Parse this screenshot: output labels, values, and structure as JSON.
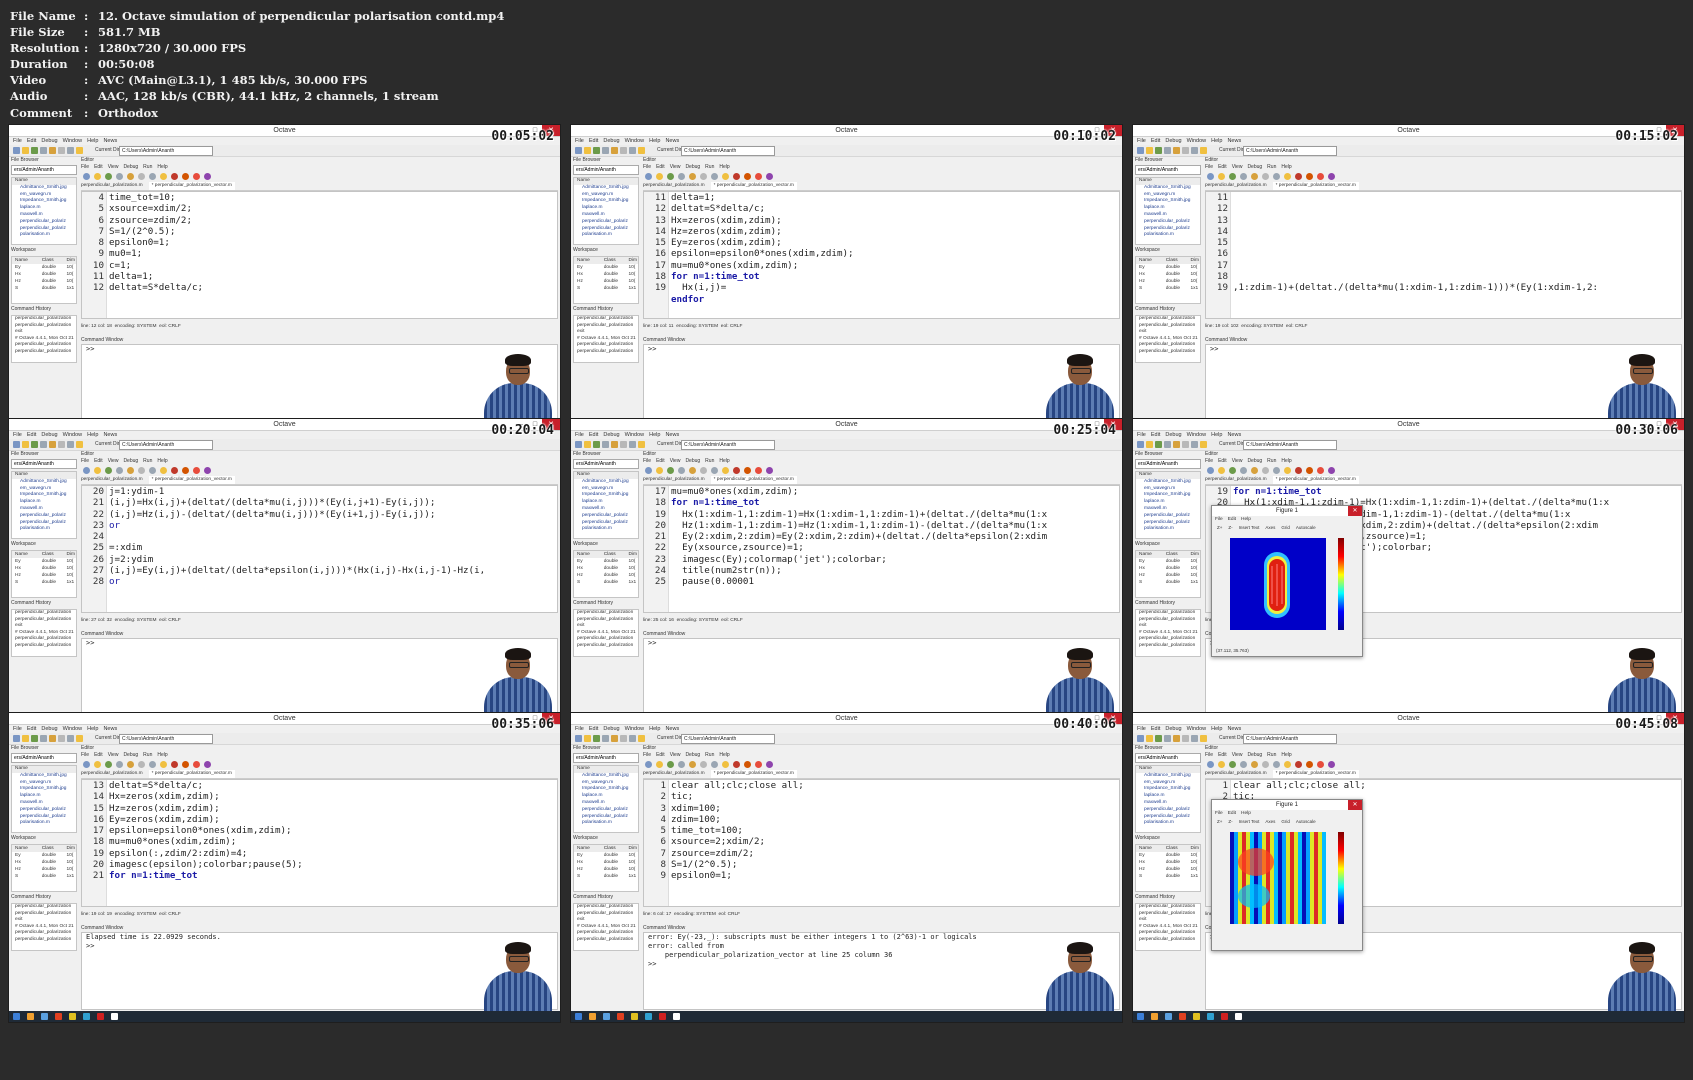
{
  "meta": [
    {
      "key": "File Name",
      "value": "12. Octave simulation of perpendicular polarisation contd.mp4"
    },
    {
      "key": "File Size",
      "value": "581.7 MB"
    },
    {
      "key": "Resolution",
      "value": "1280x720 / 30.000 FPS"
    },
    {
      "key": "Duration",
      "value": "00:50:08"
    },
    {
      "key": "Video",
      "value": "AVC (Main@L3.1), 1 485 kb/s, 30.000 FPS"
    },
    {
      "key": "Audio",
      "value": "AAC, 128 kb/s (CBR), 44.1 kHz, 2 channels, 1 stream"
    },
    {
      "key": "Comment",
      "value": "Orthodox"
    }
  ],
  "app": {
    "title": "Octave",
    "menus": [
      "File",
      "Edit",
      "Debug",
      "Window",
      "Help",
      "News"
    ],
    "current_dir_label": "Current Directory:",
    "current_dir": "C:\\Users\\Admin\\Ananth",
    "file_browser_title": "File Browser",
    "file_browser_path": "ers/Admin/Ananth",
    "file_list_header": "Name",
    "files": [
      "Admittance_Smith.jpg",
      "em_wavegn.m",
      "Impedance_Smith.jpg",
      "laplace.m",
      "maxwell.m",
      "perpendicular_polariz",
      "perpendicular_polariz",
      "polarisation.m"
    ],
    "workspace_title": "Workspace",
    "workspace_filter": "Filter",
    "workspace_cols": [
      "Name",
      "Class",
      "Dim"
    ],
    "workspace_rows": [
      {
        "name": "Ey",
        "class": "double",
        "dim": "10("
      },
      {
        "name": "Hx",
        "class": "double",
        "dim": "10("
      },
      {
        "name": "Hz",
        "class": "double",
        "dim": "10("
      },
      {
        "name": "S",
        "class": "double",
        "dim": "1x1"
      }
    ],
    "history_title": "Command History",
    "history_filter": "Filter",
    "history_items": [
      "perpendicular_polarization",
      "perpendicular_polarization",
      "exit",
      "# Octave 4.4.1, Mon Oct 21",
      "perpendicular_polarization",
      "perpendicular_polarization"
    ],
    "editor_title": "Editor",
    "editor_menus": [
      "File",
      "Edit",
      "View",
      "Debug",
      "Run",
      "Help"
    ],
    "tabs": [
      "perpendicular_polarization.m",
      "* perpendicular_polarization_vector.m"
    ],
    "status_encoding": "encoding: SYSTEM",
    "status_eol": "eol: CRLF",
    "command_window_title": "Command Window",
    "prompt": ">>"
  },
  "figure": {
    "title": "Figure 1",
    "menus": [
      "File",
      "Edit",
      "Help"
    ],
    "tools": [
      "Z+",
      "Z-",
      "Insert Text",
      "Axes",
      "Grid",
      "Autoscale"
    ],
    "status": "(37.112, 35.763)"
  },
  "thumbs": [
    {
      "timestamp": "00:05:02",
      "status_pos": "line: 12   col: 18",
      "code": [
        {
          "n": "4",
          "t": "time_tot=10;"
        },
        {
          "n": "5",
          "t": "xsource=xdim/2;"
        },
        {
          "n": "6",
          "t": "zsource=zdim/2;"
        },
        {
          "n": "7",
          "t": "S=1/(2^0.5);"
        },
        {
          "n": "8",
          "t": "epsilon0=1;"
        },
        {
          "n": "9",
          "t": "mu0=1;"
        },
        {
          "n": "10",
          "t": "c=1;"
        },
        {
          "n": "11",
          "t": "delta=1;"
        },
        {
          "n": "12",
          "t": "deltat=S*delta/c;"
        }
      ],
      "cmd": [
        ">>"
      ],
      "figure": null
    },
    {
      "timestamp": "00:10:02",
      "status_pos": "line: 19   col: 11",
      "code": [
        {
          "n": "11",
          "t": "delta=1;"
        },
        {
          "n": "12",
          "t": "deltat=S*delta/c;"
        },
        {
          "n": "13",
          "t": "Hx=zeros(xdim,zdim);"
        },
        {
          "n": "14",
          "t": "Hz=zeros(xdim,zdim);"
        },
        {
          "n": "15",
          "t": "Ey=zeros(xdim,zdim);"
        },
        {
          "n": "16",
          "t": "epsilon=epsilon0*ones(xdim,zdim);"
        },
        {
          "n": "17",
          "t": "mu=mu0*ones(xdim,zdim);"
        },
        {
          "n": "18",
          "t": "for n=1:time_tot"
        },
        {
          "n": "19",
          "t": "  Hx(i,j)="
        },
        {
          "n": "",
          "t": "endfor"
        }
      ],
      "cmd": [
        ">>"
      ],
      "figure": null
    },
    {
      "timestamp": "00:15:02",
      "status_pos": "line: 19   col: 102",
      "code": [
        {
          "n": "11",
          "t": ""
        },
        {
          "n": "12",
          "t": ""
        },
        {
          "n": "13",
          "t": ""
        },
        {
          "n": "14",
          "t": ""
        },
        {
          "n": "15",
          "t": ""
        },
        {
          "n": "16",
          "t": ""
        },
        {
          "n": "17",
          "t": ""
        },
        {
          "n": "18",
          "t": ""
        },
        {
          "n": "19",
          "t": ",1:zdim-1)+(deltat./(delta*mu(1:xdim-1,1:zdim-1)))*(Ey(1:xdim-1,2:"
        }
      ],
      "cmd": [
        ">>"
      ],
      "figure": null
    },
    {
      "timestamp": "00:20:04",
      "status_pos": "line: 27   col: 32",
      "code": [
        {
          "n": "20",
          "t": "j=1:ydim-1"
        },
        {
          "n": "21",
          "t": "(i,j)=Hx(i,j)+(deltat/(delta*mu(i,j)))*(Ey(i,j+1)-Ey(i,j));"
        },
        {
          "n": "22",
          "t": "(i,j)=Hz(i,j)-(deltat/(delta*mu(i,j)))*(Ey(i+1,j)-Ey(i,j));"
        },
        {
          "n": "23",
          "t": "or"
        },
        {
          "n": "24",
          "t": ""
        },
        {
          "n": "25",
          "t": "=:xdim"
        },
        {
          "n": "26",
          "t": "j=2:ydim"
        },
        {
          "n": "27",
          "t": "(i,j)=Ey(i,j)+(deltat/(delta*epsilon(i,j)))*(Hx(i,j)-Hx(i,j-1)-Hz(i,"
        },
        {
          "n": "28",
          "t": "or"
        }
      ],
      "cmd": [
        ">>"
      ],
      "figure": null
    },
    {
      "timestamp": "00:25:04",
      "status_pos": "line: 25   col: 16",
      "code": [
        {
          "n": "17",
          "t": "mu=mu0*ones(xdim,zdim);"
        },
        {
          "n": "18",
          "t": "for n=1:time_tot"
        },
        {
          "n": "19",
          "t": "  Hx(1:xdim-1,1:zdim-1)=Hx(1:xdim-1,1:zdim-1)+(deltat./(delta*mu(1:x"
        },
        {
          "n": "20",
          "t": "  Hz(1:xdim-1,1:zdim-1)=Hz(1:xdim-1,1:zdim-1)-(deltat./(delta*mu(1:x"
        },
        {
          "n": "21",
          "t": "  Ey(2:xdim,2:zdim)=Ey(2:xdim,2:zdim)+(deltat./(delta*epsilon(2:xdim"
        },
        {
          "n": "22",
          "t": "  Ey(xsource,zsource)=1;"
        },
        {
          "n": "23",
          "t": "  imagesc(Ey);colormap('jet');colorbar;"
        },
        {
          "n": "24",
          "t": "  title(num2str(n));"
        },
        {
          "n": "25",
          "t": "  pause(0.00001"
        }
      ],
      "cmd": [
        ">>"
      ],
      "figure": null
    },
    {
      "timestamp": "00:30:06",
      "status_pos": "line: 25   col: 16",
      "code": [
        {
          "n": "19",
          "t": "for n=1:time_tot"
        },
        {
          "n": "20",
          "t": "  Hx(1:xdim-1,1:zdim-1)=Hx(1:xdim-1,1:zdim-1)+(deltat./(delta*mu(1:x"
        },
        {
          "n": "21",
          "t": "                    1:xdim-1,1:zdim-1)-(deltat./(delta*mu(1:x"
        },
        {
          "n": "22",
          "t": "                    (2:xdim,2:zdim)+(deltat./(delta*epsilon(2:xdim"
        },
        {
          "n": "23",
          "t": "                    +25,zsource)=1;"
        },
        {
          "n": "24",
          "t": "                    'jet');colorbar;"
        },
        {
          "n": "25",
          "t": ""
        }
      ],
      "cmd": [
        ">>"
      ],
      "figure": {
        "kind": "pill"
      }
    },
    {
      "timestamp": "00:35:06",
      "status_pos": "line: 19   col: 19",
      "code": [
        {
          "n": "13",
          "t": "deltat=S*delta/c;"
        },
        {
          "n": "14",
          "t": "Hx=zeros(xdim,zdim);"
        },
        {
          "n": "15",
          "t": "Hz=zeros(xdim,zdim);"
        },
        {
          "n": "16",
          "t": "Ey=zeros(xdim,zdim);"
        },
        {
          "n": "17",
          "t": "epsilon=epsilon0*ones(xdim,zdim);"
        },
        {
          "n": "18",
          "t": "mu=mu0*ones(xdim,zdim);"
        },
        {
          "n": "19",
          "t": "epsilon(:,zdim/2:zdim)=4;"
        },
        {
          "n": "20",
          "t": "imagesc(epsilon);colorbar;pause(5);"
        },
        {
          "n": "21",
          "t": "for n=1:time_tot"
        }
      ],
      "cmd": [
        "Elapsed time is 22.0929 seconds.",
        ">>"
      ],
      "figure": null
    },
    {
      "timestamp": "00:40:06",
      "status_pos": "line: 6   col: 17",
      "code": [
        {
          "n": "1",
          "t": "clear all;clc;close all;"
        },
        {
          "n": "2",
          "t": "tic;"
        },
        {
          "n": "3",
          "t": "xdim=100;"
        },
        {
          "n": "4",
          "t": "zdim=100;"
        },
        {
          "n": "5",
          "t": "time_tot=100;"
        },
        {
          "n": "6",
          "t": "xsource=2;xdim/2;"
        },
        {
          "n": "7",
          "t": "zsource=zdim/2;"
        },
        {
          "n": "8",
          "t": "S=1/(2^0.5);"
        },
        {
          "n": "9",
          "t": "epsilon0=1;"
        }
      ],
      "cmd": [
        "error: Ey(-23,_): subscripts must be either integers 1 to (2^63)-1 or logicals",
        "error: called from",
        "    perpendicular_polarization_vector at line 25 column 36",
        ">>"
      ],
      "figure": null
    },
    {
      "timestamp": "00:45:08",
      "status_pos": "line: 1   col: 1",
      "code": [
        {
          "n": "1",
          "t": "clear all;clc;close all;"
        },
        {
          "n": "2",
          "t": "tic;"
        }
      ],
      "cmd": [
        ">>"
      ],
      "figure": {
        "kind": "waves"
      }
    }
  ]
}
